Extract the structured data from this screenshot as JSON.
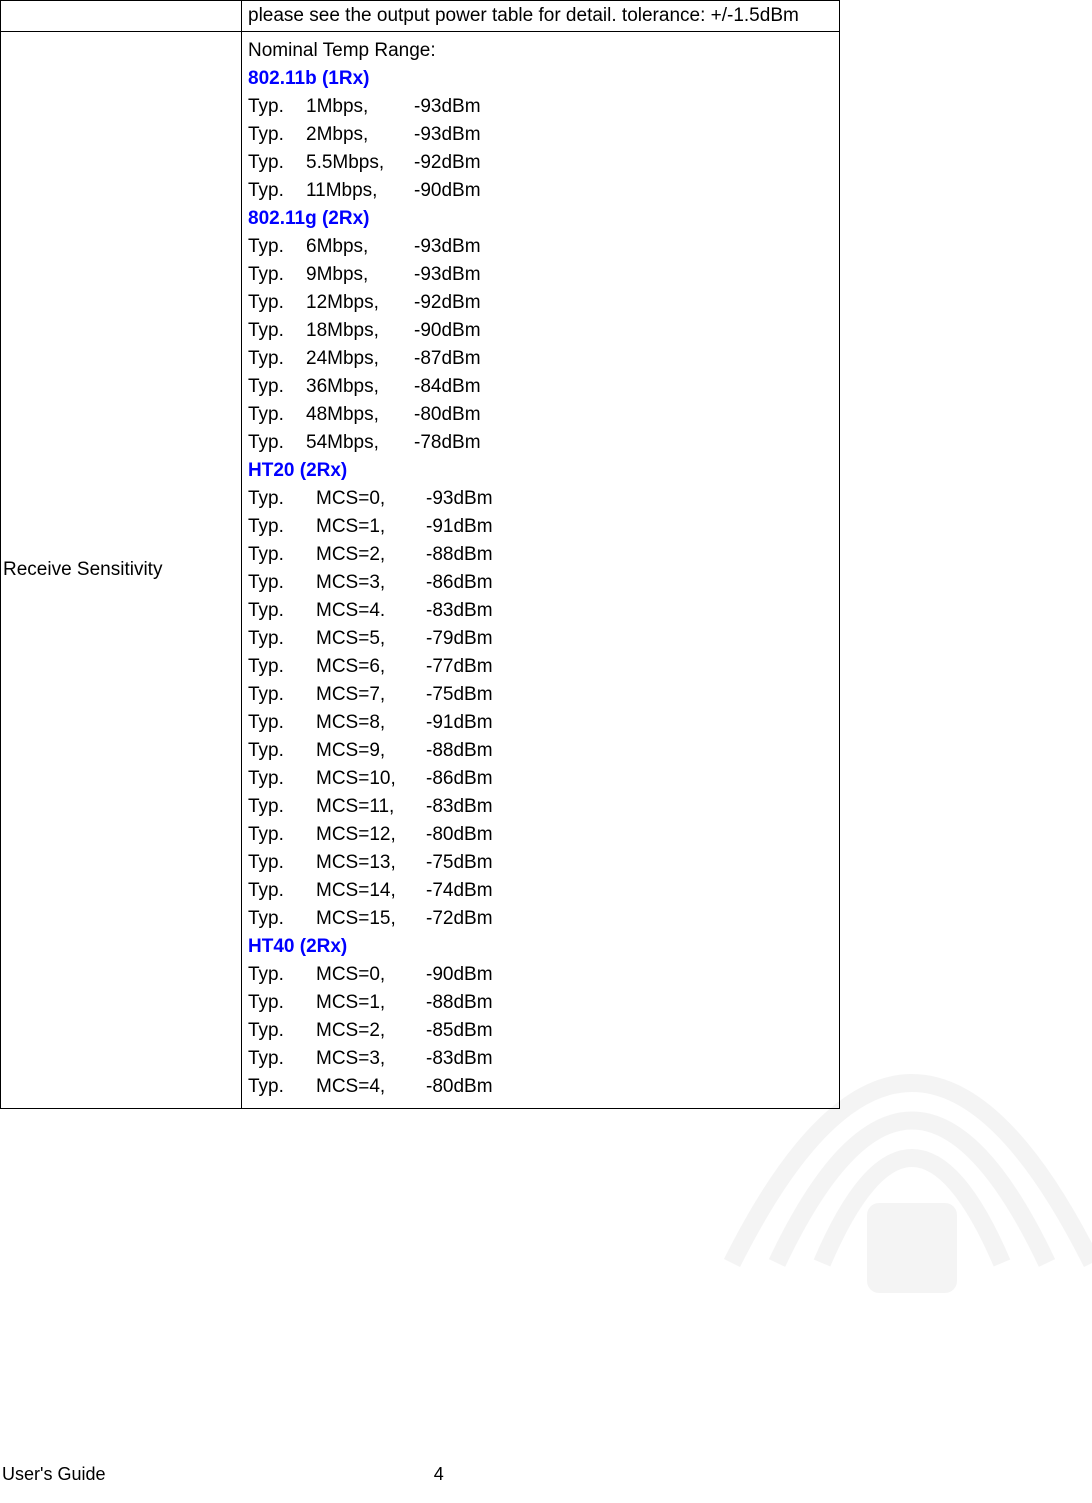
{
  "top_row_note": "please see the output power table for detail. tolerance: +/-1.5dBm",
  "label_receive_sensitivity": "Receive Sensitivity",
  "nominal_temp": "Nominal Temp Range:",
  "sections": {
    "b": {
      "title": "802.11b (1Rx)",
      "rows": [
        {
          "c1": "Typ.",
          "c2": "1Mbps,",
          "c3": "-93dBm"
        },
        {
          "c1": "Typ.",
          "c2": "2Mbps,",
          "c3": "-93dBm"
        },
        {
          "c1": "Typ.",
          "c2": "5.5Mbps,",
          "c3": "-92dBm"
        },
        {
          "c1": "Typ.",
          "c2": "11Mbps,",
          "c3": "-90dBm"
        }
      ]
    },
    "g": {
      "title": "802.11g (2Rx)",
      "rows": [
        {
          "c1": "Typ.",
          "c2": "6Mbps,",
          "c3": "-93dBm"
        },
        {
          "c1": "Typ.",
          "c2": "9Mbps,",
          "c3": "-93dBm"
        },
        {
          "c1": "Typ.",
          "c2": "12Mbps,",
          "c3": "-92dBm"
        },
        {
          "c1": "Typ.",
          "c2": "18Mbps,",
          "c3": "-90dBm"
        },
        {
          "c1": "Typ.",
          "c2": "24Mbps,",
          "c3": "-87dBm"
        },
        {
          "c1": "Typ.",
          "c2": "36Mbps,",
          "c3": "-84dBm"
        },
        {
          "c1": "Typ.",
          "c2": "48Mbps,",
          "c3": "-80dBm"
        },
        {
          "c1": "Typ.",
          "c2": "54Mbps,",
          "c3": "-78dBm"
        }
      ]
    },
    "ht20": {
      "title": "HT20 (2Rx)",
      "rows": [
        {
          "c1": "Typ.",
          "c2": "MCS=0,",
          "c3": "-93dBm"
        },
        {
          "c1": "Typ.",
          "c2": "MCS=1,",
          "c3": "-91dBm"
        },
        {
          "c1": "Typ.",
          "c2": "MCS=2,",
          "c3": "-88dBm"
        },
        {
          "c1": "Typ.",
          "c2": "MCS=3,",
          "c3": "-86dBm"
        },
        {
          "c1": "Typ.",
          "c2": "MCS=4.",
          "c3": "-83dBm"
        },
        {
          "c1": "Typ.",
          "c2": "MCS=5,",
          "c3": "-79dBm"
        },
        {
          "c1": "Typ.",
          "c2": "MCS=6,",
          "c3": "-77dBm"
        },
        {
          "c1": "Typ.",
          "c2": "MCS=7,",
          "c3": "-75dBm"
        },
        {
          "c1": "Typ.",
          "c2": "MCS=8,",
          "c3": "-91dBm"
        },
        {
          "c1": "Typ.",
          "c2": "MCS=9,",
          "c3": "-88dBm"
        },
        {
          "c1": "Typ.",
          "c2": "MCS=10,",
          "c3": "-86dBm"
        },
        {
          "c1": "Typ.",
          "c2": "MCS=11,",
          "c3": "-83dBm"
        },
        {
          "c1": "Typ.",
          "c2": "MCS=12,",
          "c3": "-80dBm"
        },
        {
          "c1": "Typ.",
          "c2": "MCS=13,",
          "c3": "-75dBm"
        },
        {
          "c1": "Typ.",
          "c2": "MCS=14,",
          "c3": "-74dBm"
        },
        {
          "c1": "Typ.",
          "c2": "MCS=15,",
          "c3": "-72dBm"
        }
      ]
    },
    "ht40": {
      "title": "HT40 (2Rx)",
      "rows": [
        {
          "c1": "Typ.",
          "c2": "MCS=0,",
          "c3": "-90dBm"
        },
        {
          "c1": "Typ.",
          "c2": "MCS=1,",
          "c3": "-88dBm"
        },
        {
          "c1": "Typ.",
          "c2": "MCS=2,",
          "c3": "-85dBm"
        },
        {
          "c1": "Typ.",
          "c2": "MCS=3,",
          "c3": "-83dBm"
        },
        {
          "c1": "Typ.",
          "c2": "MCS=4,",
          "c3": "-80dBm"
        }
      ]
    }
  },
  "footer": {
    "left": "User's Guide",
    "page": "4"
  }
}
